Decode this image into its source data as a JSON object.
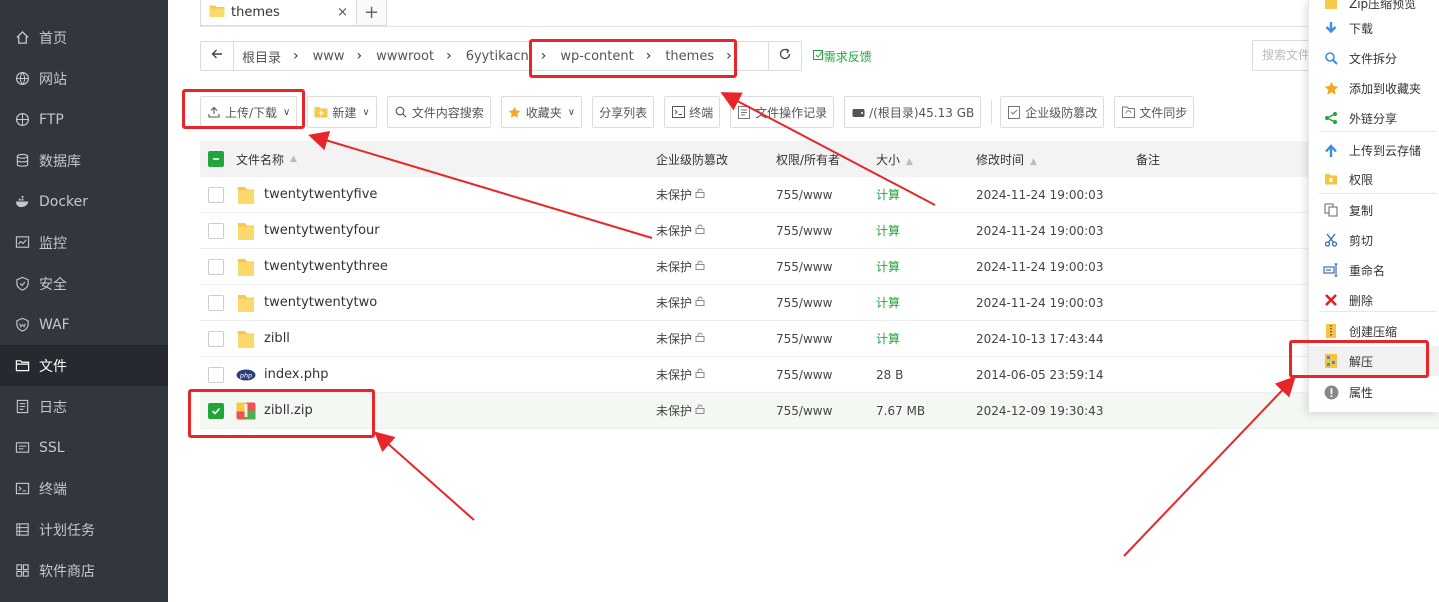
{
  "sidebar": {
    "items": [
      {
        "label": "首页",
        "icon": "home-icon"
      },
      {
        "label": "网站",
        "icon": "globe-icon"
      },
      {
        "label": "FTP",
        "icon": "ftp-icon"
      },
      {
        "label": "数据库",
        "icon": "database-icon"
      },
      {
        "label": "Docker",
        "icon": "docker-icon"
      },
      {
        "label": "监控",
        "icon": "monitor-icon"
      },
      {
        "label": "安全",
        "icon": "shield-icon"
      },
      {
        "label": "WAF",
        "icon": "waf-icon"
      },
      {
        "label": "文件",
        "icon": "folder-icon",
        "active": true
      },
      {
        "label": "日志",
        "icon": "log-icon"
      },
      {
        "label": "SSL",
        "icon": "ssl-icon"
      },
      {
        "label": "终端",
        "icon": "terminal-icon"
      },
      {
        "label": "计划任务",
        "icon": "schedule-icon"
      },
      {
        "label": "软件商店",
        "icon": "store-icon"
      }
    ]
  },
  "tabs": [
    {
      "label": "themes",
      "close": "×"
    }
  ],
  "tab_add": "+",
  "breadcrumb": [
    "根目录",
    "www",
    "wwwroot",
    "6yytikacn",
    "wp-content",
    "themes"
  ],
  "feedback": "需求反馈",
  "search": {
    "placeholder": "搜索文件"
  },
  "toolbar": {
    "upload": "上传/下载",
    "new": "新建",
    "content_search": "文件内容搜索",
    "favorites": "收藏夹",
    "share_list": "分享列表",
    "terminal": "终端",
    "op_log": "文件操作记录",
    "disk": "/(根目录)45.13 GB",
    "tamper": "企业级防篡改",
    "sync": "文件同步"
  },
  "table": {
    "headers": {
      "name": "文件名称",
      "protect": "企业级防篡改",
      "perm": "权限/所有者",
      "size": "大小",
      "mtime": "修改时间",
      "note": "备注"
    },
    "rows": [
      {
        "name": "twentytwentyfive",
        "type": "folder",
        "protect": "未保护",
        "perm": "755/www",
        "size": "计算",
        "mtime": "2024-11-24 19:00:03",
        "checked": false
      },
      {
        "name": "twentytwentyfour",
        "type": "folder",
        "protect": "未保护",
        "perm": "755/www",
        "size": "计算",
        "mtime": "2024-11-24 19:00:03",
        "checked": false
      },
      {
        "name": "twentytwentythree",
        "type": "folder",
        "protect": "未保护",
        "perm": "755/www",
        "size": "计算",
        "mtime": "2024-11-24 19:00:03",
        "checked": false
      },
      {
        "name": "twentytwentytwo",
        "type": "folder",
        "protect": "未保护",
        "perm": "755/www",
        "size": "计算",
        "mtime": "2024-11-24 19:00:03",
        "checked": false
      },
      {
        "name": "zibll",
        "type": "folder",
        "protect": "未保护",
        "perm": "755/www",
        "size": "计算",
        "mtime": "2024-10-13 17:43:44",
        "checked": false
      },
      {
        "name": "index.php",
        "type": "php",
        "protect": "未保护",
        "perm": "755/www",
        "size": "28 B",
        "mtime": "2014-06-05 23:59:14",
        "checked": false
      },
      {
        "name": "zibll.zip",
        "type": "zip",
        "protect": "未保护",
        "perm": "755/www",
        "size": "7.67 MB",
        "mtime": "2024-12-09 19:30:43",
        "checked": true
      }
    ]
  },
  "context_menu": {
    "items": [
      {
        "label": "Zip压缩预览",
        "icon": "zip-preview-icon"
      },
      {
        "label": "下载",
        "icon": "download-icon",
        "color": "#3b8fe0"
      },
      {
        "label": "文件拆分",
        "icon": "split-icon",
        "color": "#3b8fe0"
      },
      {
        "label": "添加到收藏夹",
        "icon": "star-icon",
        "color": "#f5a623"
      },
      {
        "label": "外链分享",
        "icon": "share-icon",
        "color": "#20a53a"
      },
      {
        "label": "上传到云存储",
        "icon": "upload-cloud-icon",
        "color": "#3b8fe0"
      },
      {
        "label": "权限",
        "icon": "permission-icon",
        "color": "#f5c542"
      },
      {
        "label": "复制",
        "icon": "copy-icon",
        "color": "#666"
      },
      {
        "label": "剪切",
        "icon": "cut-icon",
        "color": "#3b6fb0"
      },
      {
        "label": "重命名",
        "icon": "rename-icon",
        "color": "#3b6fb0"
      },
      {
        "label": "删除",
        "icon": "delete-icon",
        "color": "#e02020"
      },
      {
        "label": "创建压缩",
        "icon": "compress-icon",
        "color": "#f5c542"
      },
      {
        "label": "解压",
        "icon": "extract-icon",
        "color": "#f5c542",
        "hover": true
      },
      {
        "label": "属性",
        "icon": "info-icon",
        "color": "#888"
      }
    ]
  },
  "colors": {
    "accent": "#20a53a",
    "annotation": "#e8262a",
    "sidebar": "#32363e"
  }
}
